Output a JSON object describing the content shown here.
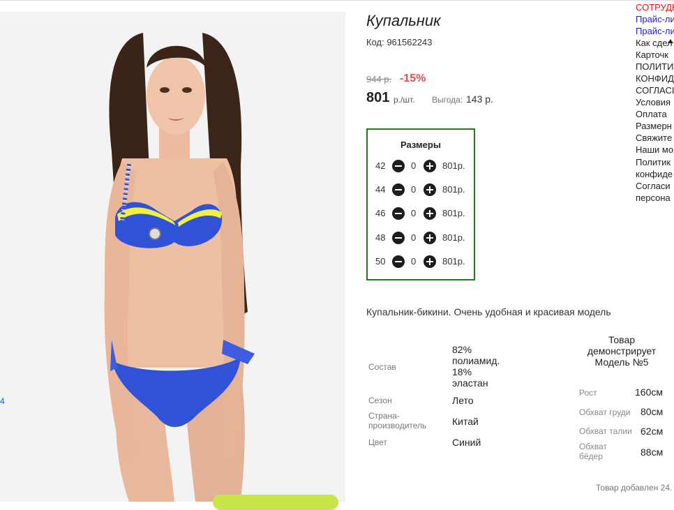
{
  "product": {
    "title": "Купальник",
    "code": "Код: 961562243",
    "old_price": "944 р.",
    "discount": "-15%",
    "price": "801",
    "price_unit": "р./шт.",
    "benefit_label": "Выгода:",
    "benefit_value": "143 р.",
    "description": "Купальник-бикини. Очень удобная и красивая модель"
  },
  "sizes": {
    "title": "Размеры",
    "rows": [
      {
        "size": "42",
        "qty": "0",
        "price": "801р."
      },
      {
        "size": "44",
        "qty": "0",
        "price": "801р."
      },
      {
        "size": "46",
        "qty": "0",
        "price": "801р."
      },
      {
        "size": "48",
        "qty": "0",
        "price": "801р."
      },
      {
        "size": "50",
        "qty": "0",
        "price": "801р."
      }
    ]
  },
  "characteristics": {
    "composition_label": "Состав",
    "composition_value": "82% полиамид. 18% эластан",
    "season_label": "Сезон",
    "season_value": "Лето",
    "country_label": "Страна-производитель",
    "country_value": "Китай",
    "color_label": "Цвет",
    "color_value": "Синий"
  },
  "model": {
    "title": "Товар демонстрирует Модель №5",
    "height_label": "Рост",
    "height_value": "160см",
    "chest_label": "Обхват груди",
    "chest_value": "80см",
    "waist_label": "Обхват талии",
    "waist_value": "62см",
    "hips_label": "Обхват бёдер",
    "hips_value": "88см"
  },
  "added_text": "Товар добавлен 24.",
  "left_edge_text": "4",
  "side_menu": [
    {
      "label": "СОТРУДН",
      "color": "#e01010"
    },
    {
      "label": "Прайс-ли",
      "color": "#1a1adf"
    },
    {
      "label": "Прайс-ли",
      "color": "#1a1adf"
    },
    {
      "label": "Как сдел",
      "color": "#222222"
    },
    {
      "label": "Карточк",
      "color": "#222222"
    },
    {
      "label": "ПОЛИТИ",
      "color": "#222222"
    },
    {
      "label": "КОНФИД",
      "color": "#222222"
    },
    {
      "label": "СОГЛАСІ",
      "color": "#222222"
    },
    {
      "label": "Условия",
      "color": "#222222"
    },
    {
      "label": "Оплата",
      "color": "#222222"
    },
    {
      "label": "Размерн",
      "color": "#222222"
    },
    {
      "label": "Свяжите",
      "color": "#222222"
    },
    {
      "label": "Наши мо",
      "color": "#222222"
    },
    {
      "label": "Политик",
      "color": "#222222"
    },
    {
      "label": "конфиде",
      "color": "#222222"
    },
    {
      "label": "Согласи",
      "color": "#222222"
    },
    {
      "label": "персона",
      "color": "#222222"
    }
  ],
  "colors": {
    "accent_green": "#1e7b1e",
    "discount_red": "#e05050",
    "swimsuit_blue": "#2f52d6",
    "cart_button": "#c8e64a"
  }
}
